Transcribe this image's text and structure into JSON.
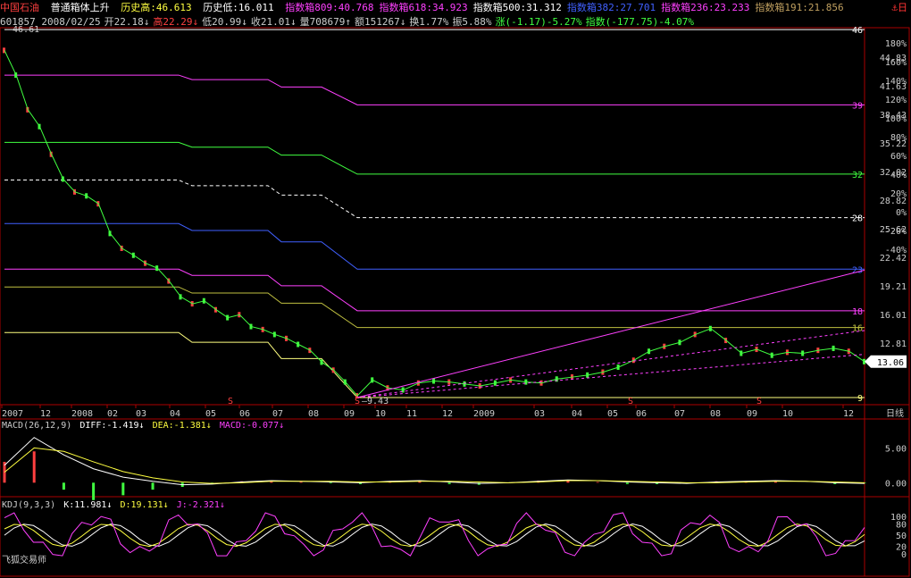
{
  "header": {
    "stock_name": "中国石油",
    "pattern": "普通箱体上升",
    "hist_high": "历史高:46.613",
    "hist_low": "历史低:16.011",
    "idx": [
      {
        "text": "指数箱809:40.768",
        "color": "#ff40ff"
      },
      {
        "text": "指数箱618:34.923",
        "color": "#ff40ff"
      },
      {
        "text": "指数箱500:31.312",
        "color": "#ffffff"
      },
      {
        "text": "指数箱382:27.701",
        "color": "#4060ff"
      },
      {
        "text": "指数箱236:23.233",
        "color": "#ff40ff"
      },
      {
        "text": "指数箱191:21.856",
        "color": "#c0a060"
      }
    ],
    "corner": "⚓日"
  },
  "info": [
    {
      "text": "601857 2008/02/25",
      "color": "#cccccc"
    },
    {
      "text": "开22.18↓",
      "color": "#cccccc"
    },
    {
      "text": "高22.29↓",
      "color": "#ff4040"
    },
    {
      "text": "低20.99↓",
      "color": "#cccccc"
    },
    {
      "text": "收21.01↓",
      "color": "#cccccc"
    },
    {
      "text": "量708679↑",
      "color": "#cccccc"
    },
    {
      "text": "额151267↓",
      "color": "#cccccc"
    },
    {
      "text": "换1.77%",
      "color": "#cccccc"
    },
    {
      "text": "振5.88%",
      "color": "#cccccc"
    },
    {
      "text": "涨(-1.17)-5.27%",
      "color": "#40ff40"
    },
    {
      "text": "指数(-177.75)-4.07%",
      "color": "#40ff40"
    }
  ],
  "chart_data": [
    {
      "type": "line",
      "title": "",
      "price_labels": [
        "44.83",
        "41.63",
        "38.43",
        "35.22",
        "32.02",
        "28.82",
        "25.62",
        "22.42",
        "19.21",
        "16.01",
        "12.81"
      ],
      "pct_labels": [
        "180%",
        "160%",
        "140%",
        "120%",
        "100%",
        "80%",
        "60%",
        "40%",
        "20%",
        "0%",
        "-20%",
        "-40%"
      ],
      "x_ticks": [
        "2007",
        "12",
        "2008",
        "02",
        "03",
        "04",
        "05",
        "06",
        "07",
        "08",
        "09",
        "10",
        "11",
        "12",
        "2009",
        "03",
        "04",
        "05",
        "06",
        "07",
        "08",
        "09",
        "10",
        "12"
      ],
      "ylim": [
        9.43,
        46.61
      ],
      "high_label": "46.61",
      "low_label": "9.43",
      "current_price": "13.06",
      "period_label": "日线",
      "box_lines_right": [
        "46",
        "39",
        "32",
        "28",
        "23",
        "18",
        "16",
        "9"
      ],
      "s_markers": [
        "S",
        "S",
        "S",
        "S"
      ],
      "close_series": [
        44.5,
        42.0,
        38.5,
        36.8,
        34.0,
        31.5,
        30.2,
        29.8,
        29.0,
        26.0,
        24.5,
        23.8,
        23.0,
        22.5,
        21.2,
        19.6,
        18.9,
        19.2,
        18.3,
        17.5,
        17.8,
        16.6,
        16.3,
        15.8,
        15.4,
        14.8,
        14.2,
        13.0,
        12.2,
        11.0,
        9.6,
        11.2,
        10.4,
        10.2,
        10.9,
        11.1,
        11.0,
        10.8,
        10.6,
        10.9,
        11.2,
        11.0,
        10.9,
        11.3,
        11.5,
        11.7,
        12.0,
        12.5,
        13.2,
        14.1,
        14.6,
        15.0,
        15.8,
        16.4,
        15.2,
        13.9,
        14.3,
        13.7,
        14.0,
        13.9,
        14.2,
        14.4,
        14.1,
        13.06
      ],
      "box_levels": [
        {
          "name": "46",
          "color": "#ffffff",
          "values": [
            46.6,
            46.6
          ]
        },
        {
          "name": "39",
          "color": "#ff40ff",
          "values": [
            42.0,
            39.0
          ]
        },
        {
          "name": "32",
          "color": "#40ff40",
          "values": [
            35.2,
            32.0
          ]
        },
        {
          "name": "28",
          "color": "#ffffff",
          "values": [
            31.4,
            27.6
          ]
        },
        {
          "name": "23",
          "color": "#4060ff",
          "values": [
            27.0,
            22.4
          ]
        },
        {
          "name": "18",
          "color": "#ff40ff",
          "values": [
            22.4,
            18.2
          ]
        },
        {
          "name": "16",
          "color": "#c0c040",
          "values": [
            20.6,
            16.5
          ]
        },
        {
          "name": "9",
          "color": "#ffff80",
          "values": [
            16.0,
            9.43
          ]
        }
      ]
    },
    {
      "type": "bar",
      "title": "MACD(26,12,9)",
      "ylim": [
        -1.5,
        8
      ],
      "y_ticks": [
        "5.00",
        "0.00"
      ],
      "series": [
        {
          "name": "DIFF",
          "label": "DIFF:-1.419↓",
          "color": "#ffffff"
        },
        {
          "name": "DEA",
          "label": "DEA:-1.381↓",
          "color": "#ffff40"
        },
        {
          "name": "MACD",
          "label": "MACD:-0.077↓",
          "color": "#ff40ff"
        }
      ],
      "diff": [
        2.5,
        6.5,
        4.0,
        2.0,
        0.8,
        0.2,
        -0.3,
        -0.2,
        0.1,
        0.3,
        0.2,
        0.1,
        0.0,
        0.2,
        0.3,
        0.1,
        -0.1,
        0.0,
        0.2,
        0.4,
        0.3,
        0.1,
        0.0,
        -0.1,
        0.1,
        0.2,
        0.3,
        0.2,
        0.0,
        -0.1
      ],
      "dea": [
        1.5,
        5.0,
        4.5,
        3.0,
        1.6,
        0.7,
        0.1,
        -0.1,
        0.0,
        0.2,
        0.2,
        0.2,
        0.1,
        0.1,
        0.2,
        0.2,
        0.1,
        0.0,
        0.1,
        0.3,
        0.3,
        0.2,
        0.1,
        0.0,
        0.0,
        0.1,
        0.2,
        0.2,
        0.1,
        0.0
      ],
      "macd": [
        3.0,
        4.5,
        -1.0,
        -2.5,
        -1.8,
        -1.0,
        -0.6,
        -0.2,
        0.2,
        0.3,
        0.1,
        -0.1,
        -0.2,
        0.2,
        0.3,
        -0.2,
        -0.3,
        0.0,
        0.3,
        0.3,
        0.1,
        -0.2,
        -0.2,
        -0.1,
        0.2,
        0.2,
        0.2,
        0.0,
        -0.2,
        -0.1
      ]
    },
    {
      "type": "line",
      "title": "KDJ(9,3,3)",
      "ylim": [
        0,
        110
      ],
      "y_ticks": [
        "100",
        "80",
        "50",
        "20",
        "0"
      ],
      "series": [
        {
          "name": "K",
          "label": "K:11.981↓",
          "color": "#ffffff"
        },
        {
          "name": "D",
          "label": "D:19.131↓",
          "color": "#ffff40"
        },
        {
          "name": "J",
          "label": "J:-2.321↓",
          "color": "#ff40ff"
        }
      ]
    }
  ],
  "footer": "飞狐交易师"
}
